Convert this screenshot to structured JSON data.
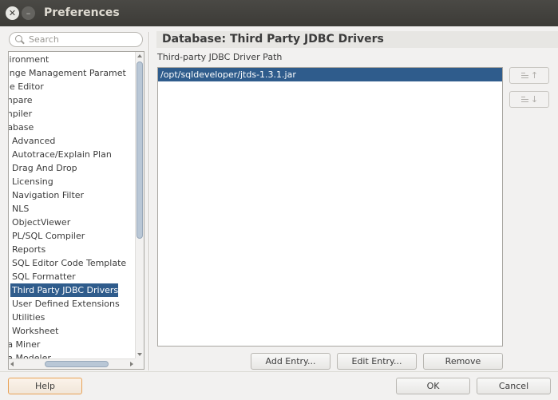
{
  "window": {
    "title": "Preferences"
  },
  "search": {
    "placeholder": "Search"
  },
  "tree": {
    "items": [
      {
        "label": "vironment",
        "level": 0
      },
      {
        "label": "ange Management Paramet",
        "level": 0
      },
      {
        "label": "de Editor",
        "level": 0
      },
      {
        "label": "mpare",
        "level": 0
      },
      {
        "label": "mpiler",
        "level": 0
      },
      {
        "label": "tabase",
        "level": 0
      },
      {
        "label": "Advanced",
        "level": 1
      },
      {
        "label": "Autotrace/Explain Plan",
        "level": 1
      },
      {
        "label": "Drag And Drop",
        "level": 1
      },
      {
        "label": "Licensing",
        "level": 1
      },
      {
        "label": "Navigation Filter",
        "level": 1
      },
      {
        "label": "NLS",
        "level": 1
      },
      {
        "label": "ObjectViewer",
        "level": 1
      },
      {
        "label": "PL/SQL Compiler",
        "level": 1
      },
      {
        "label": "Reports",
        "level": 1
      },
      {
        "label": "SQL Editor Code Template",
        "level": 1
      },
      {
        "label": "SQL Formatter",
        "level": 1
      },
      {
        "label": "Third Party JDBC Drivers",
        "level": 1,
        "selected": true
      },
      {
        "label": "User Defined Extensions",
        "level": 1
      },
      {
        "label": "Utilities",
        "level": 1
      },
      {
        "label": "Worksheet",
        "level": 1
      },
      {
        "label": "ta Miner",
        "level": 0
      },
      {
        "label": "ta Modeler",
        "level": 0
      }
    ]
  },
  "panel": {
    "header": "Database: Third Party JDBC Drivers",
    "path_label": "Third-party JDBC Driver Path",
    "drivers": [
      "/opt/sqldeveloper/jtds-1.3.1.jar"
    ]
  },
  "buttons": {
    "add_entry": "Add Entry...",
    "edit_entry": "Edit Entry...",
    "remove": "Remove",
    "help": "Help",
    "ok": "OK",
    "cancel": "Cancel"
  },
  "colors": {
    "selection": "#2f5c8c",
    "titlebar": "#3c3b37",
    "help_focus": "#e8a257"
  }
}
